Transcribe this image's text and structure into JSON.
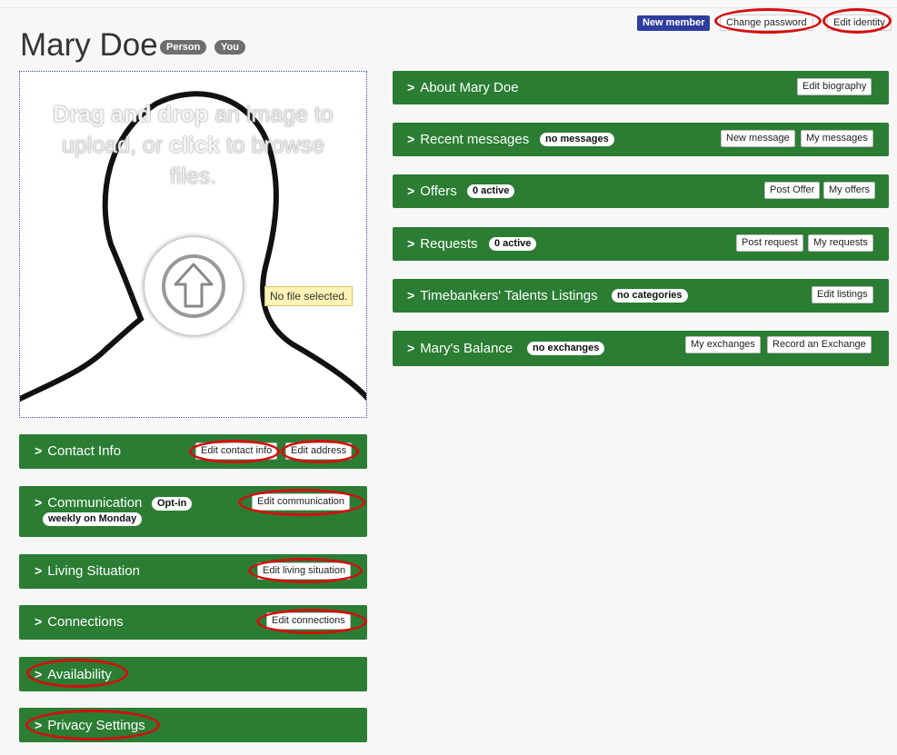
{
  "header": {
    "title": "Mary Doe",
    "tags": [
      "Person",
      "You"
    ],
    "status_badge": "New member",
    "change_password_label": "Change password",
    "edit_identity_label": "Edit identity"
  },
  "upload": {
    "text_bold_1": "Drag and drop",
    "text_1": " an image to upload, or ",
    "text_bold_2": "click",
    "text_2": " to browse files.",
    "no_file": "No file selected."
  },
  "left_panels": {
    "contact": {
      "title": "Contact Info",
      "buttons": [
        "Edit contact info",
        "Edit address"
      ]
    },
    "communication": {
      "title": "Communication",
      "badge": "Opt-in",
      "badge2": "weekly on Monday",
      "button": "Edit communication"
    },
    "living": {
      "title": "Living Situation",
      "button": "Edit living situation"
    },
    "connections": {
      "title": "Connections",
      "button": "Edit connections"
    },
    "availability": {
      "title": "Availability"
    },
    "privacy": {
      "title": "Privacy Settings"
    }
  },
  "right_panels": {
    "about": {
      "title": "About Mary Doe",
      "buttons": [
        "Edit biography"
      ]
    },
    "messages": {
      "title": "Recent messages",
      "badge": "no messages",
      "buttons": [
        "New message",
        "My messages"
      ]
    },
    "offers": {
      "title": "Offers",
      "badge": "0 active",
      "buttons": [
        "Post Offer",
        "My offers"
      ]
    },
    "requests": {
      "title": "Requests",
      "badge": "0 active",
      "buttons": [
        "Post request",
        "My requests"
      ]
    },
    "talents": {
      "title": "Timebankers' Talents Listings",
      "badge": "no categories",
      "buttons": [
        "Edit listings"
      ]
    },
    "balance": {
      "title": "Mary's Balance",
      "badge": "no exchanges",
      "buttons": [
        "My exchanges",
        "Record an Exchange"
      ]
    }
  },
  "colors": {
    "panel_green": "#2a7d33",
    "annotation_red": "#d40f0f",
    "badge_blue": "#2f3e9e"
  }
}
